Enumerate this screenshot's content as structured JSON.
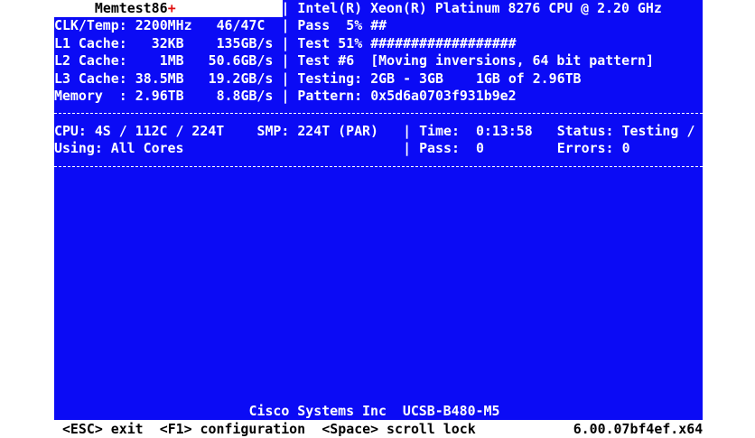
{
  "header": {
    "app_name": "Memtest86",
    "app_plus": "+",
    "cpu_name": "Intel(R) Xeon(R) Platinum 8276 CPU @ 2.20 GHz"
  },
  "system": {
    "clk_label": "CLK/Temp:",
    "clk_value": "2200MHz",
    "temp_value": "46/47C",
    "l1_label": "L1 Cache:",
    "l1_size": "32KB",
    "l1_speed": "135GB/s",
    "l2_label": "L2 Cache:",
    "l2_size": "1MB",
    "l2_speed": "50.6GB/s",
    "l3_label": "L3 Cache:",
    "l3_size": "38.5MB",
    "l3_speed": "19.2GB/s",
    "mem_label": "Memory  :",
    "mem_size": "2.96TB",
    "mem_speed": "8.8GB/s"
  },
  "progress": {
    "pass_label": "Pass",
    "pass_percent": "5%",
    "pass_bar": "##",
    "pass_fraction": 0.05,
    "test_label": "Test",
    "test_percent": "51%",
    "test_bar": "##################",
    "test_fraction": 0.51,
    "test_num_label": "Test",
    "test_num": "#6",
    "test_name": "[Moving inversions, 64 bit pattern]",
    "testing_label": "Testing:",
    "testing_range": "2GB - 3GB",
    "testing_amount": "1GB of 2.96TB",
    "pattern_label": "Pattern:",
    "pattern_value": "0x5d6a0703f931b9e2"
  },
  "status": {
    "cpu_info": "CPU: 4S / 112C / 224T",
    "smp_info": "SMP: 224T (PAR)",
    "time_label": "Time:",
    "time_value": "0:13:58",
    "status_label": "Status:",
    "status_value": "Testing",
    "spinner": "/",
    "using": "Using: All Cores",
    "pass_label": "Pass:",
    "pass_value": "0",
    "errors_label": "Errors:",
    "errors_value": "0"
  },
  "system_name": "Cisco Systems Inc  UCSB-B480-M5",
  "footer": {
    "esc": "<ESC> exit",
    "f1": "<F1> configuration",
    "space": "<Space> scroll lock",
    "version": "6.00.07bf4ef.x64"
  },
  "sep": "|"
}
